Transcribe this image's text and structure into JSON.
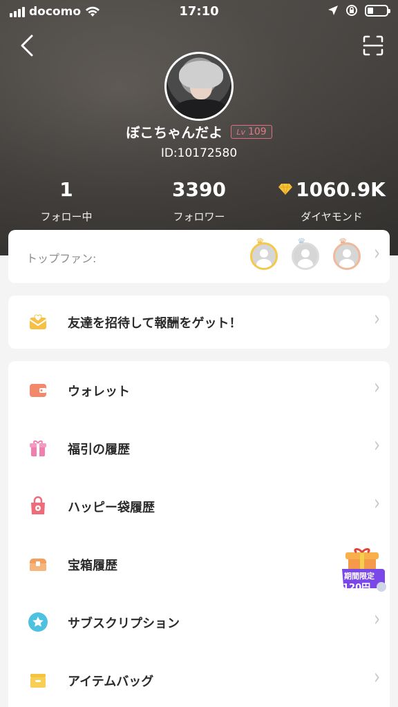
{
  "status_bar": {
    "carrier": "docomo",
    "time": "17:10"
  },
  "profile": {
    "name": "ぼこちゃんだよ",
    "level_prefix": "Lv",
    "level": "109",
    "id_text": "ID:10172580"
  },
  "stats": [
    {
      "value": "1",
      "label": "フォロー中"
    },
    {
      "value": "3390",
      "label": "フォロワー"
    },
    {
      "value": "1060.9K",
      "label": "ダイヤモンド"
    }
  ],
  "top_fans": {
    "label": "トップファン:"
  },
  "invite": {
    "label": "友達を招待して報酬をゲット！"
  },
  "menu": [
    {
      "label": "ウォレット",
      "icon": "wallet-icon"
    },
    {
      "label": "福引の履歴",
      "icon": "gift-icon"
    },
    {
      "label": "ハッピー袋履歴",
      "icon": "happy-bag-icon"
    },
    {
      "label": "宝箱履歴",
      "icon": "treasure-box-icon"
    },
    {
      "label": "サブスクリプション",
      "icon": "star-icon"
    },
    {
      "label": "アイテムバッグ",
      "icon": "item-bag-icon"
    }
  ],
  "promo": {
    "line1": "期間限定",
    "line2": "120円"
  },
  "colors": {
    "accent_orange": "#f3a05f",
    "level_pink": "#e47784",
    "diamond_gold": "#f5c33b"
  }
}
